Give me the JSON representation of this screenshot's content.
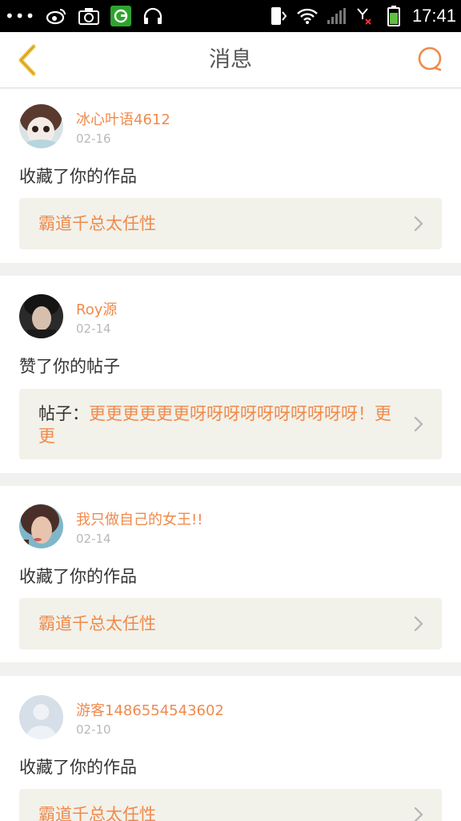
{
  "status_bar": {
    "time": "17:41",
    "left_icons": [
      "dots-icon",
      "weibo-icon",
      "camera-icon",
      "green-app-icon",
      "headphones-icon"
    ],
    "right_icons": [
      "phone-signal-icon",
      "wifi-icon",
      "signal-icon",
      "no-sim-icon",
      "battery-icon"
    ]
  },
  "header": {
    "title": "消息",
    "back_icon": "chevron-left-icon",
    "search_icon": "search-icon"
  },
  "colors": {
    "accent": "#f08a4b",
    "back_icon": "#f2c13a",
    "box_bg": "#f2f1ea",
    "page_bg": "#f1f1ef"
  },
  "messages": [
    {
      "user": "冰心叶语4612",
      "date": "02-16",
      "action": "收藏了你的作品",
      "target_prefix": "",
      "target": "霸道千总太任性"
    },
    {
      "user": "Roy源",
      "date": "02-14",
      "action": "赞了你的帖子",
      "target_prefix": "帖子：",
      "target": "更更更更更更呀呀呀呀呀呀呀呀呀呀！更更"
    },
    {
      "user": "我只做自己的女王!!",
      "date": "02-14",
      "action": "收藏了你的作品",
      "target_prefix": "",
      "target": "霸道千总太任性"
    },
    {
      "user": "游客1486554543602",
      "date": "02-10",
      "action": "收藏了你的作品",
      "target_prefix": "",
      "target": "霸道千总太任性"
    }
  ]
}
